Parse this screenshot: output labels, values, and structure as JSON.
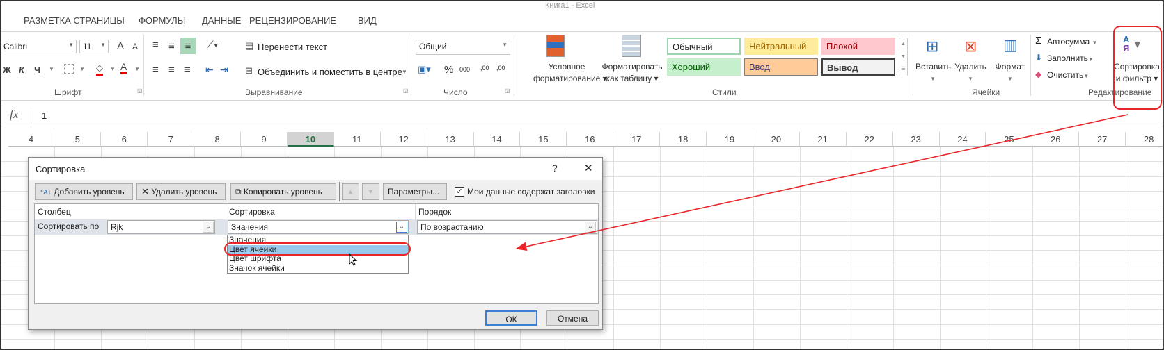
{
  "window_title": "Книга1 - Excel",
  "ribbon_tabs": [
    "РАЗМЕТКА СТРАНИЦЫ",
    "ФОРМУЛЫ",
    "ДАННЫЕ",
    "РЕЦЕНЗИРОВАНИЕ",
    "ВИД"
  ],
  "font_group": {
    "font_name": "Calibri",
    "font_size": "11",
    "bold": "Ж",
    "italic": "К",
    "underline": "Ч",
    "grow": "A",
    "shrink": "A",
    "label": "Шрифт"
  },
  "alignment_group": {
    "wrap_text": "Перенести текст",
    "merge_center": "Объединить и поместить в центре",
    "label": "Выравнивание"
  },
  "number_group": {
    "format": "Общий",
    "percent": "%",
    "thousands": "000",
    "inc_decimal": ",00",
    "dec_decimal": ",00",
    "label": "Число"
  },
  "styles_group": {
    "conditional_formatting": [
      "Условное",
      "форматирование ▾"
    ],
    "format_as_table": [
      "Форматировать",
      "как таблицу ▾"
    ],
    "cells": [
      {
        "label": "Обычный",
        "bg": "#ffffff",
        "fg": "#000000"
      },
      {
        "label": "Нейтральный",
        "bg": "#ffeb9c",
        "fg": "#9c6500"
      },
      {
        "label": "Плохой",
        "bg": "#ffc7ce",
        "fg": "#9c0006"
      },
      {
        "label": "Хороший",
        "bg": "#c6efce",
        "fg": "#006100"
      },
      {
        "label": "Ввод",
        "bg": "#ffcc99",
        "fg": "#3f3f76"
      },
      {
        "label": "Вывод",
        "bg": "#f2f2f2",
        "fg": "#3f3f3f"
      }
    ],
    "label": "Стили"
  },
  "cells_group": {
    "insert": "Вставить",
    "delete": "Удалить",
    "format": "Формат",
    "label": "Ячейки"
  },
  "editing_group": {
    "autosum": "Автосумма",
    "fill": "Заполнить",
    "clear": "Очистить",
    "sort_filter": [
      "Сортировка",
      "и фильтр ▾"
    ],
    "label": "Редактирование"
  },
  "formula_bar": {
    "fx": "fx",
    "value": "1"
  },
  "columns": [
    "4",
    "5",
    "6",
    "7",
    "8",
    "9",
    "10",
    "11",
    "12",
    "13",
    "14",
    "15",
    "16",
    "17",
    "18",
    "19",
    "20",
    "21",
    "22",
    "23",
    "24",
    "25",
    "26",
    "27",
    "28"
  ],
  "selected_column": "10",
  "dialog": {
    "title": "Сортировка",
    "help": "?",
    "close": "✕",
    "add_level": "Добавить уровень",
    "delete_level": "Удалить уровень",
    "copy_level": "Копировать уровень",
    "options": "Параметры...",
    "has_headers_label": "Мои данные содержат заголовки",
    "has_headers_checked": true,
    "headers": {
      "column": "Столбец",
      "sort_on": "Сортировка",
      "order": "Порядок"
    },
    "row": {
      "label": "Сортировать по",
      "column": "Rjk",
      "sort_on": "Значения",
      "order": "По возрастанию"
    },
    "sort_on_options": [
      "Значения",
      "Цвет ячейки",
      "Цвет шрифта",
      "Значок ячейки"
    ],
    "highlighted_option": "Цвет ячейки",
    "ok": "ОК",
    "cancel": "Отмена"
  },
  "annotation_color": "#e8262a"
}
